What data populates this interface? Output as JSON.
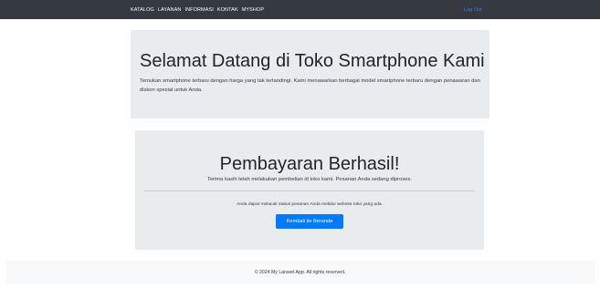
{
  "navbar": {
    "links": [
      "KATALOG",
      "LAYANAN",
      "INFORMASI",
      "KONTAK",
      "MYSHOP"
    ],
    "login": "Log Out"
  },
  "hero": {
    "title": "Selamat Datang di Toko Smartphone Kami",
    "text": "Temukan smartphone terbaru dengan harga yang tak tertandingi. Kami menawarkan berbagai model smartphone terbaru dengan penawaran dan diskon spesial untuk Anda."
  },
  "success": {
    "title": "Pembayaran Berhasil!",
    "message": "Terima kasih telah melakukan pembelian di toko kami. Pesanan Anda sedang diproses.",
    "info": "Anda dapat melacak status pesanan Anda melalui website toko yang ada.",
    "button_label": "Kembali ke Beranda"
  },
  "footer": {
    "text": "© 2024 My Laravel App. All rights reserved."
  },
  "colors": {
    "navbar": "#343a40",
    "card_bg": "#e9ecef",
    "primary": "#007bff",
    "footer_bg": "#f8f9fa"
  }
}
